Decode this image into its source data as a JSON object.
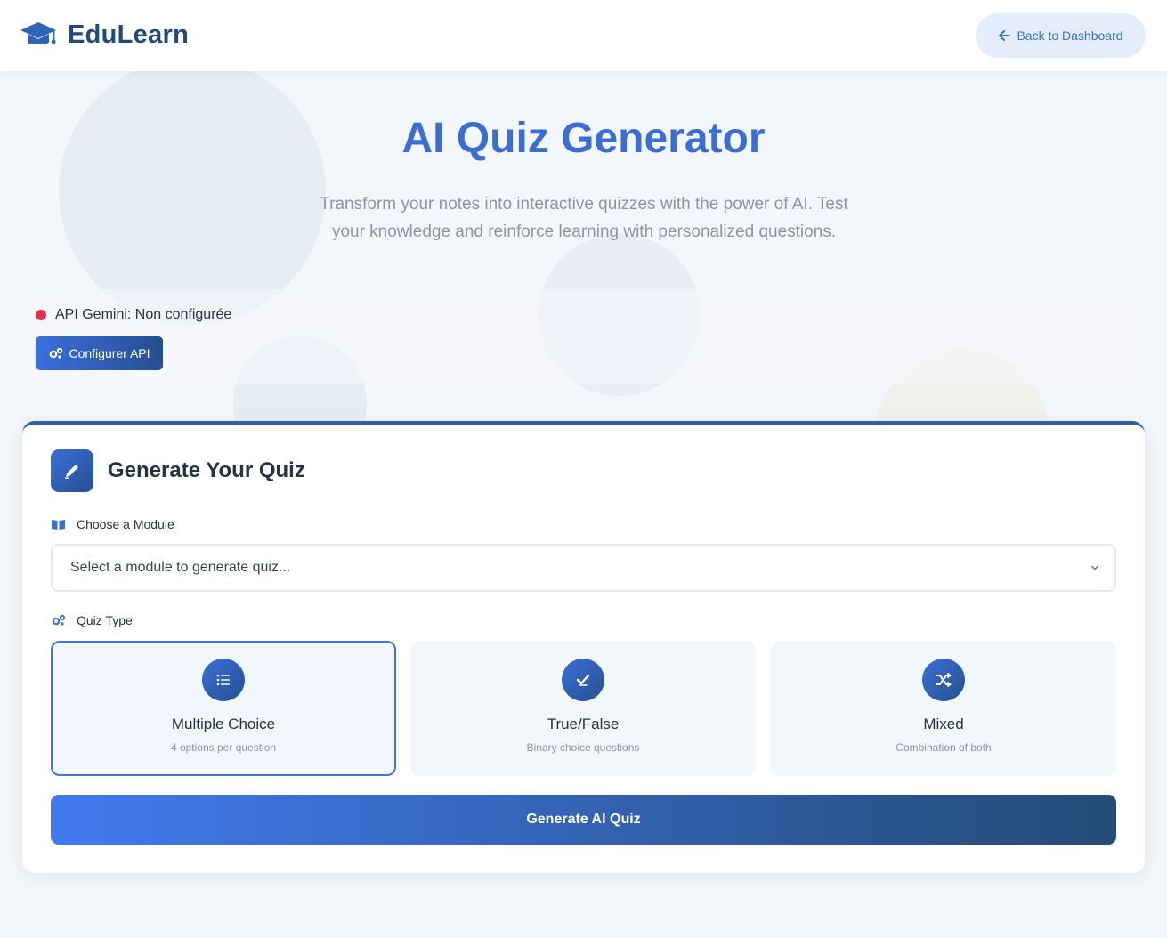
{
  "header": {
    "brand_name": "EduLearn",
    "brand_icon": "graduation-cap-icon",
    "back_label": "Back to Dashboard"
  },
  "hero": {
    "title": "AI Quiz Generator",
    "subtitle": "Transform your notes into interactive quizzes with the power of AI. Test your knowledge and reinforce learning with personalized questions."
  },
  "api": {
    "status_text": "API Gemini: Non configurée",
    "status_color": "#e0344a",
    "configure_label": "Configurer API"
  },
  "card": {
    "title": "Generate Your Quiz",
    "module_label": "Choose a Module",
    "module_placeholder": "Select a module to generate quiz...",
    "type_label": "Quiz Type",
    "types": [
      {
        "title": "Multiple Choice",
        "desc": "4 options per question",
        "icon": "list-icon",
        "selected": true
      },
      {
        "title": "True/False",
        "desc": "Binary choice questions",
        "icon": "check-icon",
        "selected": false
      },
      {
        "title": "Mixed",
        "desc": "Combination of both",
        "icon": "shuffle-icon",
        "selected": false
      }
    ],
    "generate_label": "Generate AI Quiz"
  },
  "colors": {
    "accent": "#3a6ed4",
    "brand": "#1f4a7a",
    "background": "#f3f6fa"
  }
}
